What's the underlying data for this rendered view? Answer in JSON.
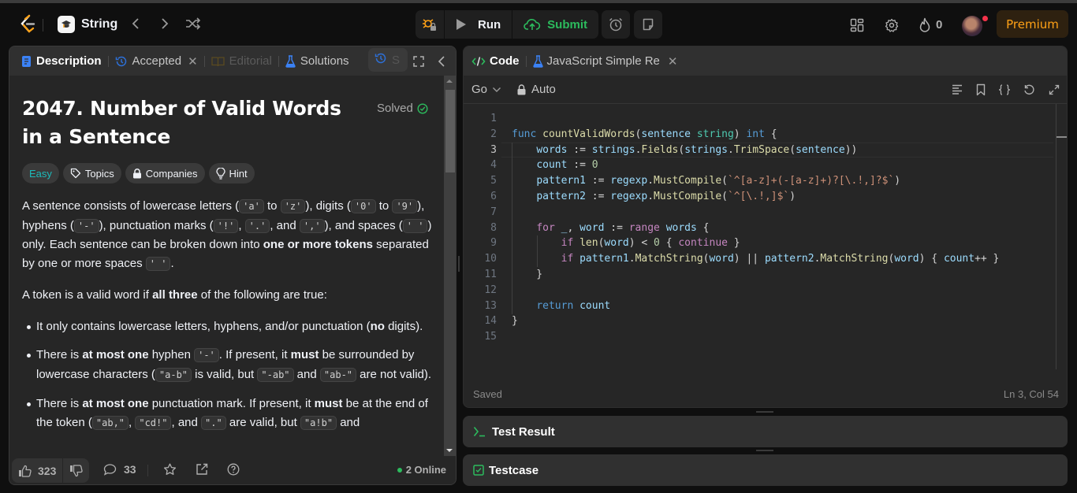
{
  "nav": {
    "study_plan_title": "String",
    "run_label": "Run",
    "submit_label": "Submit",
    "streak_count": "0",
    "premium_label": "Premium",
    "icons": [
      "leetcode-logo",
      "study-plan-icon",
      "chevron-left-icon",
      "chevron-right-icon",
      "shuffle-icon",
      "debug-locked-icon",
      "play-icon",
      "cloud-upload-icon",
      "alarm-clock-icon",
      "note-icon",
      "layout-grid-icon",
      "gear-icon",
      "flame-icon",
      "avatar"
    ]
  },
  "left_panel": {
    "tabs": [
      {
        "label": "Description",
        "icon": "document-icon",
        "active": true
      },
      {
        "label": "Accepted",
        "icon": "history-icon",
        "closable": true
      },
      {
        "label": "Editorial",
        "icon": "book-icon",
        "disabled": true
      },
      {
        "label": "Solutions",
        "icon": "flask-icon"
      },
      {
        "label": "S",
        "icon": "history-icon"
      }
    ],
    "problem": {
      "title": "2047. Number of Valid Words in a Sentence",
      "status": "Solved",
      "tags": [
        {
          "label": "Easy",
          "color": "#1cbaba"
        },
        {
          "label": "Topics",
          "icon": "tag-icon"
        },
        {
          "label": "Companies",
          "icon": "lock-icon"
        },
        {
          "label": "Hint",
          "icon": "lightbulb-icon"
        }
      ],
      "p1": {
        "t1": "A sentence consists of lowercase letters (",
        "c1": "'a'",
        "t2": " to ",
        "c2": "'z'",
        "t3": "), digits (",
        "c3": "'0'",
        "t4": " to ",
        "c4": "'9'",
        "t5": "), hyphens (",
        "c5": "'-'",
        "t6": "), punctuation marks (",
        "c6": "'!'",
        "t7": ", ",
        "c7": "'.'",
        "t8": ", and ",
        "c8": "','",
        "t9": "), and spaces (",
        "c9": "' '",
        "t10": ") only. Each sentence can be broken down into ",
        "b1": "one or more tokens",
        "t11": " separated by one or more spaces ",
        "c10": "' '",
        "t12": "."
      },
      "p2": {
        "t1": "A token is a valid word if ",
        "b1": "all three",
        "t2": " of the following are true:"
      },
      "rules": [
        {
          "t1": "It only contains lowercase letters, hyphens, and/or punctuation (",
          "b1": "no",
          "t2": " digits)."
        },
        {
          "t1": "There is ",
          "b1": "at most one",
          "t2": " hyphen ",
          "c1": "'-'",
          "t3": ". If present, it ",
          "b2": "must",
          "t4": " be surrounded by lowercase characters (",
          "c2": "\"a-b\"",
          "t5": " is valid, but ",
          "c3": "\"-ab\"",
          "t6": " and ",
          "c4": "\"ab-\"",
          "t7": " are not valid)."
        },
        {
          "t1": "There is ",
          "b1": "at most one",
          "t2": " punctuation mark. If present, it ",
          "b2": "must",
          "t3": " be at the end of the token (",
          "c1": "\"ab,\"",
          "t4": ", ",
          "c2": "\"cd!\"",
          "t5": ", and ",
          "c3": "\".\"",
          "t6": " are valid, but ",
          "c4": "\"a!b\"",
          "t7": " and"
        }
      ]
    },
    "footer": {
      "likes": "323",
      "comments": "33",
      "online": "2 Online"
    }
  },
  "right_panel": {
    "tabs": [
      {
        "label": "Code",
        "icon": "code-icon",
        "active": true
      },
      {
        "label": "JavaScript Simple Re",
        "icon": "flask-icon",
        "closable": true
      }
    ],
    "language": "Go",
    "mode": "Auto",
    "code_lines": [
      "",
      "func countValidWords(sentence string) int {",
      "    words := strings.Fields(strings.TrimSpace(sentence))",
      "    count := 0",
      "    pattern1 := regexp.MustCompile(`^[a-z]+(-[a-z]+)?[\\.!,]?$`)",
      "    pattern2 := regexp.MustCompile(`^[\\.!,]$`)",
      "",
      "    for _, word := range words {",
      "        if len(word) < 0 { continue }",
      "        if pattern1.MatchString(word) || pattern2.MatchString(word) { count++ }",
      "    }",
      "",
      "    return count",
      "}",
      ""
    ],
    "current_line": 3,
    "status_saved": "Saved",
    "cursor_pos": "Ln 3, Col 54"
  },
  "bottom_panels": {
    "test_result": "Test Result",
    "testcase": "Testcase"
  }
}
